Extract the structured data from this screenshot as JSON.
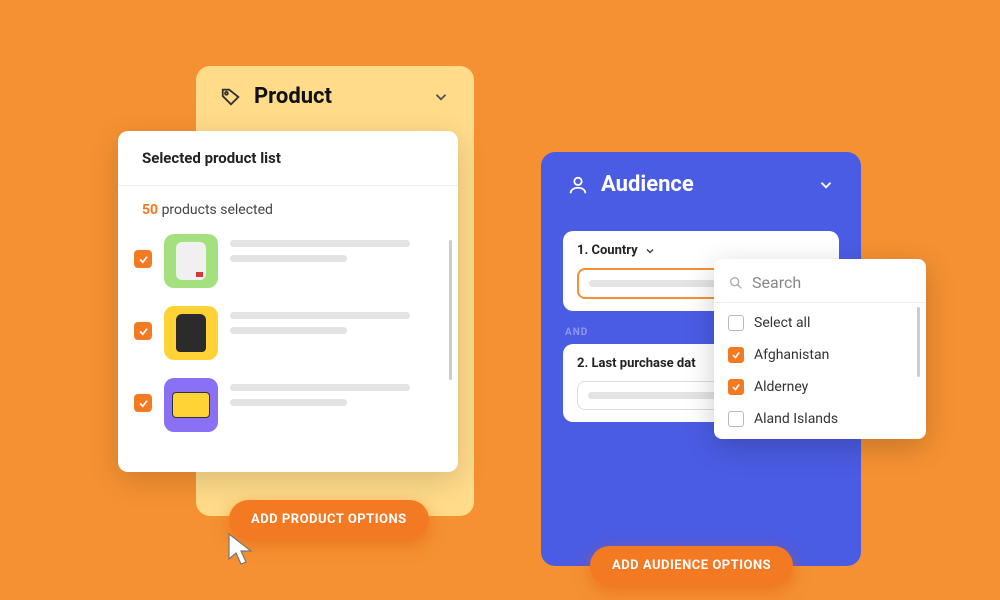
{
  "product": {
    "title": "Product",
    "popup_title": "Selected product list",
    "selected_count": "50",
    "selected_text": "products selected",
    "items": [
      {
        "checked": true
      },
      {
        "checked": true
      },
      {
        "checked": true
      }
    ],
    "button": "ADD PRODUCT OPTIONS"
  },
  "audience": {
    "title": "Audience",
    "filter1": {
      "label": "1. Country"
    },
    "and": "AND",
    "filter2": {
      "label": "2. Last purchase dat"
    },
    "button": "ADD AUDIENCE OPTIONS",
    "dropdown": {
      "search_placeholder": "Search",
      "options": [
        {
          "label": "Select all",
          "checked": false
        },
        {
          "label": "Afghanistan",
          "checked": true
        },
        {
          "label": "Alderney",
          "checked": true
        },
        {
          "label": "Aland Islands",
          "checked": false
        }
      ]
    }
  }
}
